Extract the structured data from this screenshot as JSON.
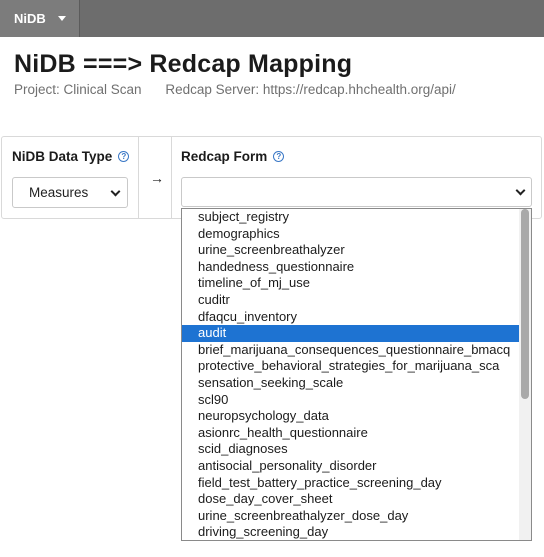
{
  "topbar": {
    "menu_label": "NiDB"
  },
  "header": {
    "title": "NiDB ===> Redcap Mapping",
    "project": "Project: Clinical Scan",
    "server": "Redcap Server: https://redcap.hhchealth.org/api/"
  },
  "form": {
    "data_type_label": "NiDB Data Type",
    "data_type_value": "Measures",
    "redcap_form_label": "Redcap Form",
    "redcap_form_value": "",
    "arrow": "→"
  },
  "dropdown": {
    "selected_index": 7,
    "options": [
      "subject_registry",
      "demographics",
      "urine_screenbreathalyzer",
      "handedness_questionnaire",
      "timeline_of_mj_use",
      "cuditr",
      "dfaqcu_inventory",
      "audit",
      "brief_marijuana_consequences_questionnaire_bmacq",
      "protective_behavioral_strategies_for_marijuana_sca",
      "sensation_seeking_scale",
      "scl90",
      "neuropsychology_data",
      "asionrc_health_questionnaire",
      "scid_diagnoses",
      "antisocial_personality_disorder",
      "field_test_battery_practice_screening_day",
      "dose_day_cover_sheet",
      "urine_screenbreathalyzer_dose_day",
      "driving_screening_day"
    ]
  },
  "colors": {
    "topbar": "#6d6d6d",
    "highlight": "#1e73d2",
    "help": "#3a78c6"
  },
  "icons": [
    "caret-down-icon",
    "help-icon",
    "arrow-right-icon",
    "chevron-down-icon"
  ]
}
